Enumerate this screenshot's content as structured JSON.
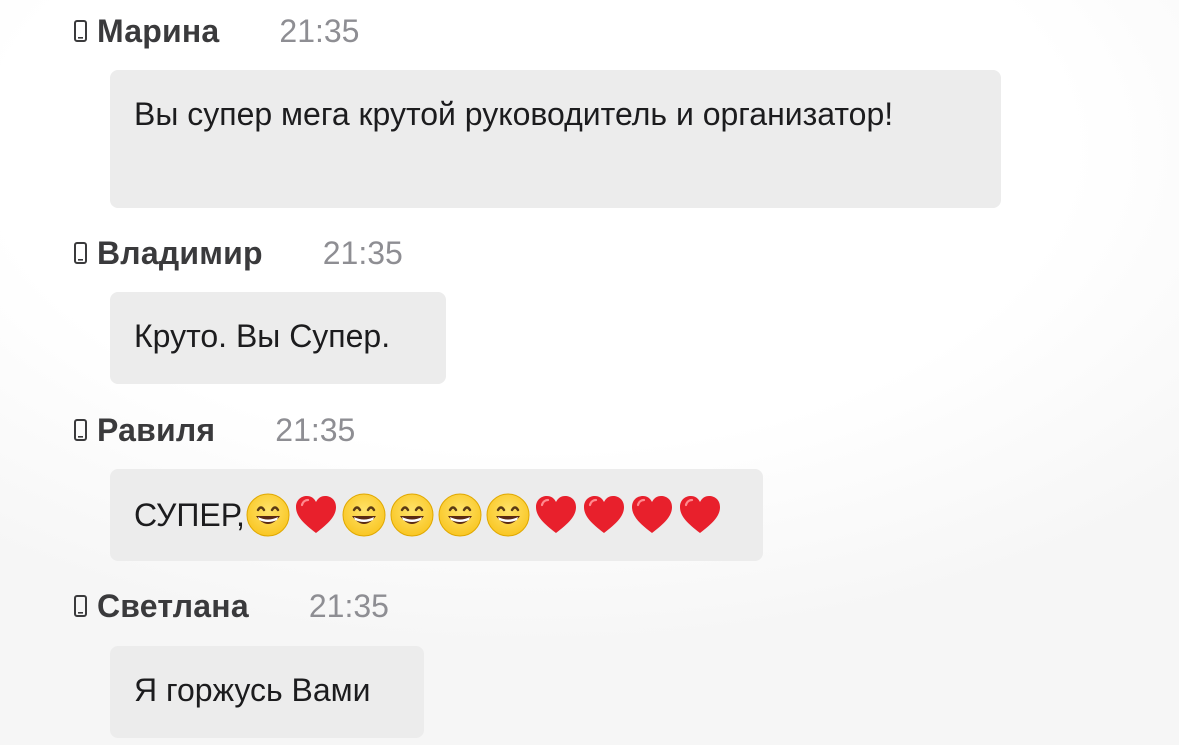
{
  "messages": [
    {
      "author": "Марина",
      "time": "21:35",
      "text": "Вы супер мега крутой руководитель и организатор!"
    },
    {
      "author": "Владимир",
      "time": "21:35",
      "text": "Круто. Вы Супер."
    },
    {
      "author": "Равиля",
      "time": "21:35",
      "text": "СУПЕР,",
      "emojis": [
        "grinning-face",
        "red-heart",
        "grinning-face",
        "grinning-face",
        "grinning-face",
        "grinning-face",
        "red-heart",
        "red-heart",
        "red-heart",
        "red-heart"
      ]
    },
    {
      "author": "Светлана",
      "time": "21:35",
      "text": "Я горжусь Вами"
    }
  ],
  "colors": {
    "bubble": "#ececec",
    "author": "#3a3a3c",
    "time": "#8e8e93",
    "text": "#1c1c1e",
    "heart": "#e8202c",
    "smile_face": "#f9c623"
  }
}
